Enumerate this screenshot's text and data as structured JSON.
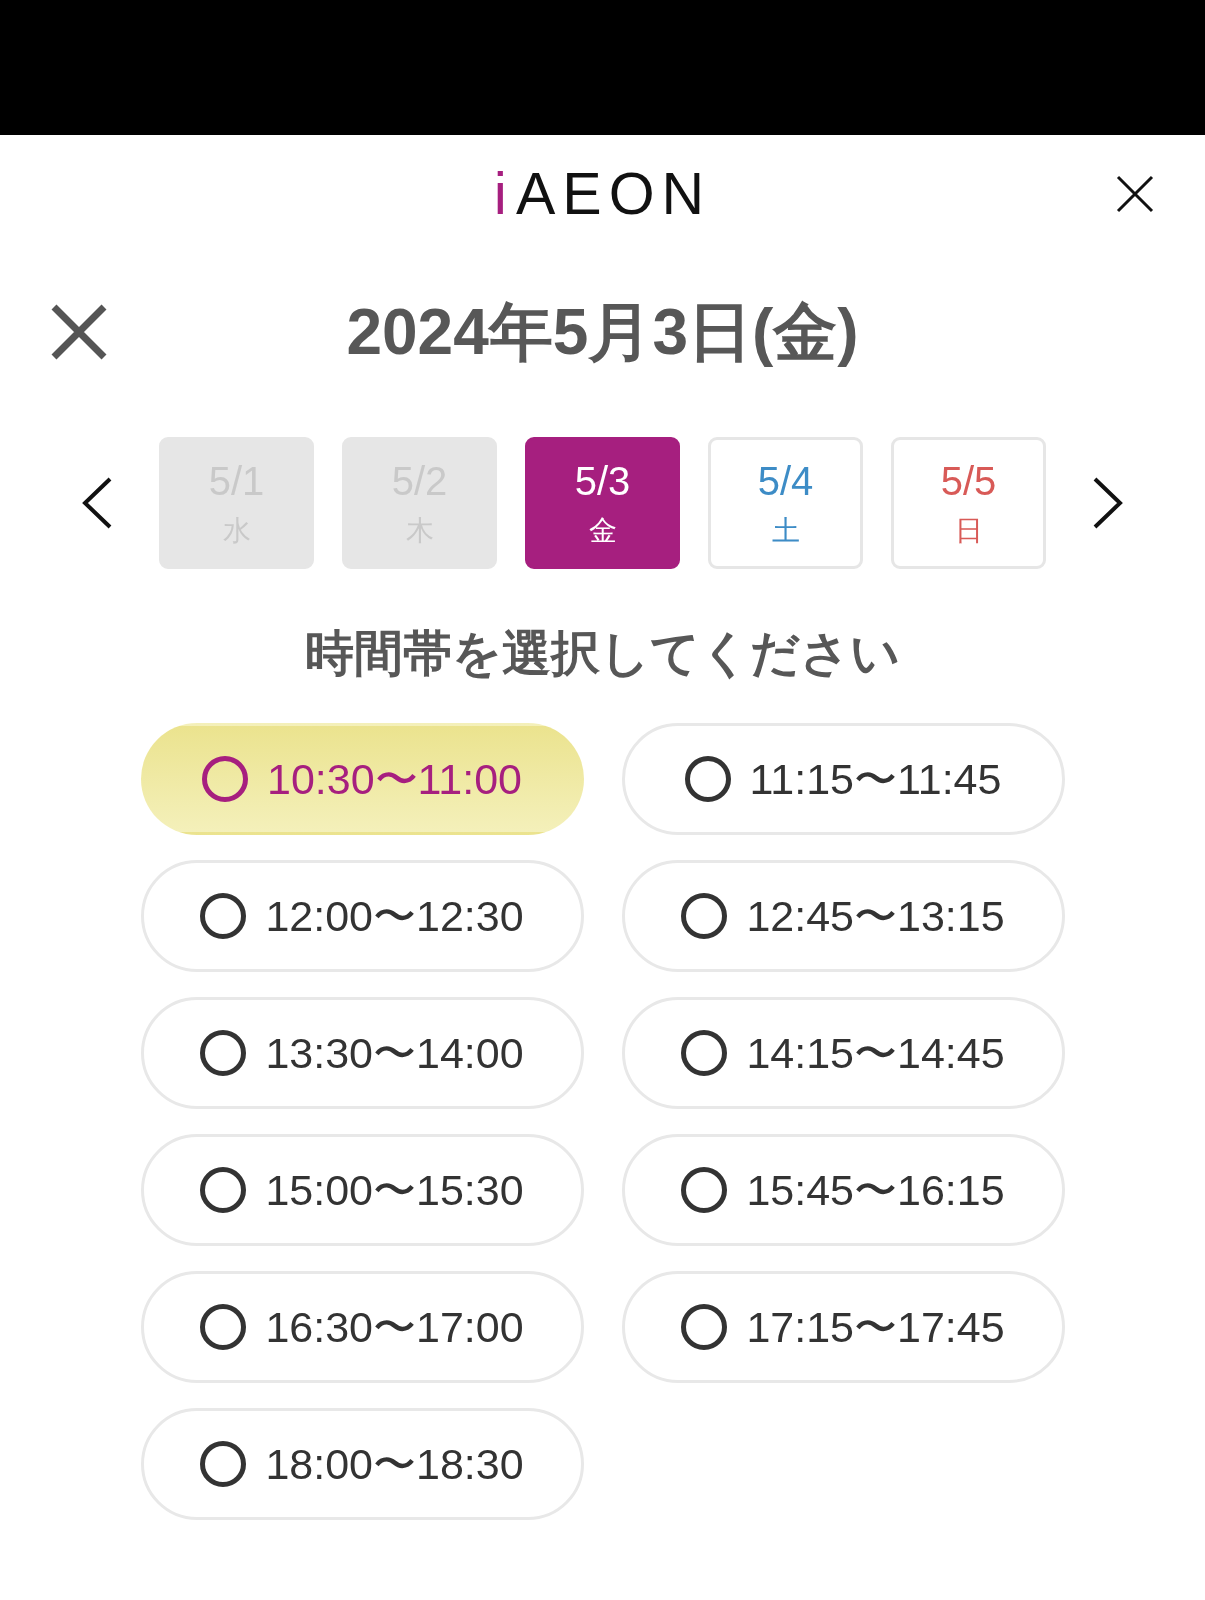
{
  "logo": {
    "accent": "i",
    "name": "AEON"
  },
  "title": "2024年5月3日(金)",
  "dates": [
    {
      "date": "5/1",
      "weekday": "水",
      "disabled": true,
      "selected": false
    },
    {
      "date": "5/2",
      "weekday": "木",
      "disabled": true,
      "selected": false
    },
    {
      "date": "5/3",
      "weekday": "金",
      "disabled": false,
      "selected": true
    },
    {
      "date": "5/4",
      "weekday": "土",
      "disabled": false,
      "selected": false,
      "color": "#3d8cc6"
    },
    {
      "date": "5/5",
      "weekday": "日",
      "disabled": false,
      "selected": false,
      "color": "#d85a57"
    }
  ],
  "prompt": "時間帯を選択してください",
  "slots": [
    {
      "time": "10:30〜11:00",
      "selected": true
    },
    {
      "time": "11:15〜11:45",
      "selected": false
    },
    {
      "time": "12:00〜12:30",
      "selected": false
    },
    {
      "time": "12:45〜13:15",
      "selected": false
    },
    {
      "time": "13:30〜14:00",
      "selected": false
    },
    {
      "time": "14:15〜14:45",
      "selected": false
    },
    {
      "time": "15:00〜15:30",
      "selected": false
    },
    {
      "time": "15:45〜16:15",
      "selected": false
    },
    {
      "time": "16:30〜17:00",
      "selected": false
    },
    {
      "time": "17:15〜17:45",
      "selected": false
    },
    {
      "time": "18:00〜18:30",
      "selected": false
    }
  ]
}
